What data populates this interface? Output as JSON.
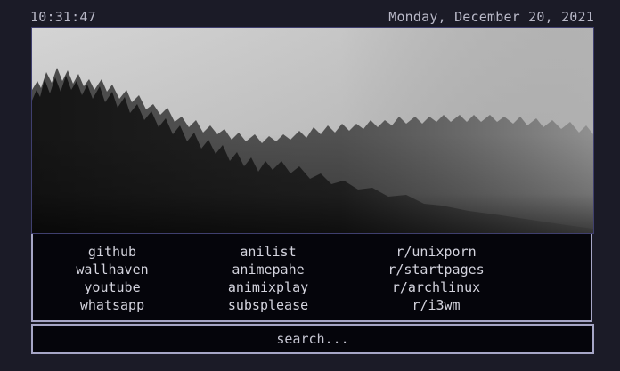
{
  "header": {
    "time": "10:31:47",
    "date": "Monday, December 20, 2021"
  },
  "hero_image": {
    "icon": "misty-forest-image"
  },
  "links": {
    "col1": [
      "github",
      "wallhaven",
      "youtube",
      "whatsapp"
    ],
    "col2": [
      "anilist",
      "animepahe",
      "animixplay",
      "subsplease"
    ],
    "col3": [
      "r/unixporn",
      "r/startpages",
      "r/archlinux",
      "r/i3wm"
    ]
  },
  "search": {
    "placeholder": "search..."
  },
  "colors": {
    "background": "#1b1b27",
    "panel": "#05050b",
    "border": "#a6a6c6",
    "text": "#d4d4de"
  }
}
